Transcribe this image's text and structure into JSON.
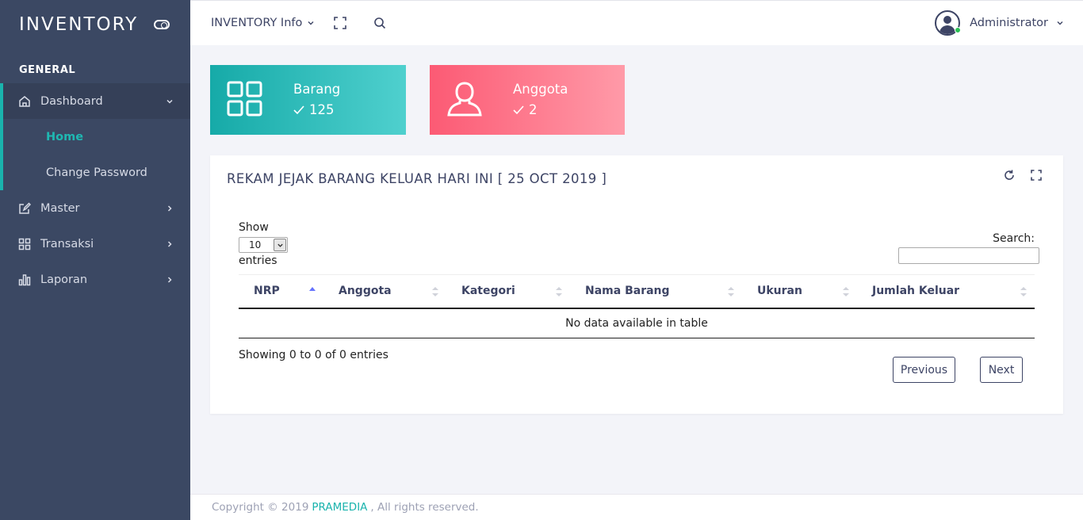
{
  "sidebar": {
    "brand": "INVENTORY",
    "section": "GENERAL",
    "dashboard_label": "Dashboard",
    "sub_items": [
      "Home",
      "Change Password"
    ],
    "items": [
      {
        "label": "Master",
        "icon": "edit-icon"
      },
      {
        "label": "Transaksi",
        "icon": "grid-icon"
      },
      {
        "label": "Laporan",
        "icon": "bar-chart-icon"
      }
    ]
  },
  "header": {
    "menu_label": "INVENTORY Info",
    "user_name": "Administrator"
  },
  "stats": [
    {
      "label": "Barang",
      "count": "125",
      "color_start": "#16aaa8",
      "color_end": "#4fd0ce"
    },
    {
      "label": "Anggota",
      "count": "2",
      "color_start": "#fc5a74",
      "color_end": "#ff9aa8"
    }
  ],
  "panel": {
    "title": "REKAM JEJAK BARANG KELUAR HARI INI [ 25 OCT 2019 ]",
    "show_label": "Show",
    "page_size": "10",
    "entries_label": "entries",
    "search_label": "Search:",
    "columns": [
      "NRP",
      "Anggota",
      "Kategori",
      "Nama Barang",
      "Ukuran",
      "Jumlah Keluar"
    ],
    "empty_text": "No data available in table",
    "info_text": "Showing 0 to 0 of 0 entries",
    "prev_label": "Previous",
    "next_label": "Next"
  },
  "footer": {
    "prefix": "Copyright © 2019",
    "link": "PRAMEDIA",
    "suffix": ", All rights reserved."
  },
  "colors": {
    "sidebar_bg": "#3b4863",
    "accent": "#1ab3ad",
    "online": "#2bc155"
  }
}
